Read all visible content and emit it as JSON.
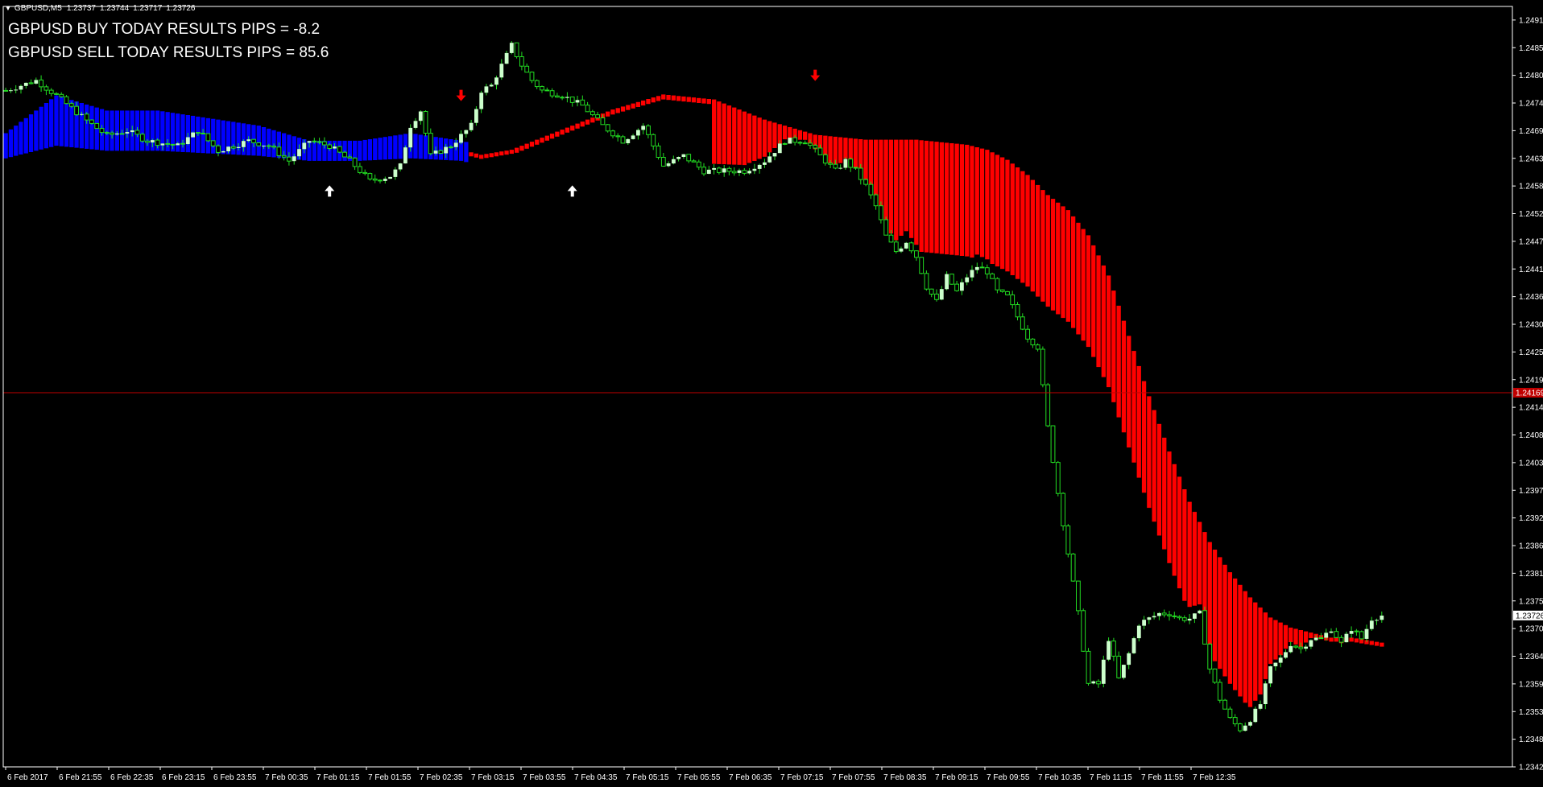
{
  "header": {
    "symbol": "GBPUSD,M5",
    "ohlc": [
      "1.23737",
      "1.23744",
      "1.23717",
      "1.23726"
    ]
  },
  "results": {
    "buy": "GBPUSD BUY TODAY RESULTS PIPS = -8.2",
    "sell": "GBPUSD SELL TODAY RESULTS PIPS = 85.6"
  },
  "colors": {
    "background": "#000000",
    "axis": "#ffffff",
    "candle_bull": "#ccffcc",
    "candle_wick": "#22dd22",
    "band_up": "#0000ff",
    "band_down": "#ff0000",
    "level_line": "#c00000",
    "arrow_buy": "#ffffff",
    "arrow_sell": "#ff0000"
  },
  "chart_data": {
    "type": "candlestick",
    "symbol": "GBPUSD",
    "timeframe": "M5",
    "ylim": [
      1.23425,
      1.24937
    ],
    "y_ticks": [
      "1.24910",
      "1.24855",
      "1.24800",
      "1.24745",
      "1.24690",
      "1.24635",
      "1.24580",
      "1.24525",
      "1.24470",
      "1.24415",
      "1.24360",
      "1.24305",
      "1.24250",
      "1.24195",
      "1.24140",
      "1.24085",
      "1.24030",
      "1.23975",
      "1.23920",
      "1.23865",
      "1.23810",
      "1.23755",
      "1.23700",
      "1.23645",
      "1.23590",
      "1.23535",
      "1.23480",
      "1.23425"
    ],
    "x_ticks": [
      "6 Feb 2017",
      "6 Feb 21:55",
      "6 Feb 22:35",
      "6 Feb 23:15",
      "6 Feb 23:55",
      "7 Feb 00:35",
      "7 Feb 01:15",
      "7 Feb 01:55",
      "7 Feb 02:35",
      "7 Feb 03:15",
      "7 Feb 03:55",
      "7 Feb 04:35",
      "7 Feb 05:15",
      "7 Feb 05:55",
      "7 Feb 06:35",
      "7 Feb 07:15",
      "7 Feb 07:55",
      "7 Feb 08:35",
      "7 Feb 09:15",
      "7 Feb 09:55",
      "7 Feb 10:35",
      "7 Feb 11:15",
      "7 Feb 11:55",
      "7 Feb 12:35"
    ],
    "horizontal_line": {
      "price": 1.24169,
      "label": "1.24169"
    },
    "current_price": {
      "price": 1.23726,
      "label": "1.23726"
    },
    "close_path": [
      [
        0,
        1.2477
      ],
      [
        6,
        1.2479
      ],
      [
        10,
        1.2476
      ],
      [
        16,
        1.2471
      ],
      [
        20,
        1.2468
      ],
      [
        24,
        1.2469
      ],
      [
        28,
        1.2467
      ],
      [
        34,
        1.2466
      ],
      [
        38,
        1.2469
      ],
      [
        42,
        1.2465
      ],
      [
        48,
        1.2467
      ],
      [
        52,
        1.2466
      ],
      [
        56,
        1.2463
      ],
      [
        60,
        1.2467
      ],
      [
        64,
        1.2466
      ],
      [
        68,
        1.2463
      ],
      [
        72,
        1.2459
      ],
      [
        76,
        1.246
      ],
      [
        78,
        1.2462
      ],
      [
        80,
        1.247
      ],
      [
        82,
        1.2473
      ],
      [
        84,
        1.2464
      ],
      [
        88,
        1.2466
      ],
      [
        92,
        1.247
      ],
      [
        94,
        1.2477
      ],
      [
        96,
        1.2478
      ],
      [
        98,
        1.2482
      ],
      [
        100,
        1.2486
      ],
      [
        102,
        1.2482
      ],
      [
        104,
        1.2479
      ],
      [
        106,
        1.2477
      ],
      [
        110,
        1.2476
      ],
      [
        114,
        1.2474
      ],
      [
        118,
        1.247
      ],
      [
        122,
        1.2467
      ],
      [
        126,
        1.247
      ],
      [
        130,
        1.2462
      ],
      [
        134,
        1.2464
      ],
      [
        138,
        1.2461
      ],
      [
        142,
        1.2461
      ],
      [
        146,
        1.2461
      ],
      [
        150,
        1.2463
      ],
      [
        154,
        1.2467
      ],
      [
        158,
        1.2467
      ],
      [
        162,
        1.2463
      ],
      [
        164,
        1.2461
      ],
      [
        166,
        1.2463
      ],
      [
        168,
        1.2461
      ],
      [
        170,
        1.2458
      ],
      [
        172,
        1.2454
      ],
      [
        174,
        1.2448
      ],
      [
        176,
        1.2445
      ],
      [
        178,
        1.2447
      ],
      [
        180,
        1.2444
      ],
      [
        182,
        1.2438
      ],
      [
        184,
        1.2435
      ],
      [
        186,
        1.244
      ],
      [
        188,
        1.2437
      ],
      [
        190,
        1.244
      ],
      [
        192,
        1.2442
      ],
      [
        194,
        1.2441
      ],
      [
        196,
        1.2437
      ],
      [
        198,
        1.2436
      ],
      [
        200,
        1.2432
      ],
      [
        202,
        1.2428
      ],
      [
        204,
        1.2426
      ],
      [
        206,
        1.241
      ],
      [
        208,
        1.2397
      ],
      [
        210,
        1.2385
      ],
      [
        212,
        1.2373
      ],
      [
        214,
        1.2359
      ],
      [
        216,
        1.2359
      ],
      [
        218,
        1.2368
      ],
      [
        220,
        1.236
      ],
      [
        222,
        1.2365
      ],
      [
        224,
        1.2371
      ],
      [
        226,
        1.2372
      ],
      [
        228,
        1.2373
      ],
      [
        230,
        1.2373
      ],
      [
        232,
        1.2372
      ],
      [
        234,
        1.2372
      ],
      [
        236,
        1.2373
      ],
      [
        238,
        1.2362
      ],
      [
        240,
        1.2356
      ],
      [
        242,
        1.2352
      ],
      [
        244,
        1.235
      ],
      [
        246,
        1.2352
      ],
      [
        248,
        1.2355
      ],
      [
        250,
        1.2362
      ],
      [
        252,
        1.2364
      ],
      [
        254,
        1.2367
      ],
      [
        256,
        1.2366
      ],
      [
        258,
        1.2368
      ],
      [
        260,
        1.2368
      ],
      [
        262,
        1.237
      ],
      [
        264,
        1.2367
      ],
      [
        266,
        1.237
      ],
      [
        268,
        1.2368
      ],
      [
        270,
        1.2372
      ],
      [
        272,
        1.23726
      ]
    ],
    "band_path": [
      [
        0,
        1.2466
      ],
      [
        10,
        1.2471
      ],
      [
        20,
        1.2469
      ],
      [
        30,
        1.2469
      ],
      [
        40,
        1.2468
      ],
      [
        50,
        1.2467
      ],
      [
        60,
        1.2465
      ],
      [
        70,
        1.2465
      ],
      [
        80,
        1.2466
      ],
      [
        90,
        1.2465
      ],
      [
        94,
        1.2464
      ],
      [
        100,
        1.2465
      ],
      [
        110,
        1.2469
      ],
      [
        120,
        1.2473
      ],
      [
        130,
        1.2476
      ],
      [
        140,
        1.2475
      ],
      [
        150,
        1.2471
      ],
      [
        160,
        1.2468
      ],
      [
        170,
        1.2467
      ],
      [
        180,
        1.2467
      ],
      [
        190,
        1.2466
      ],
      [
        194,
        1.2465
      ],
      [
        198,
        1.2463
      ],
      [
        202,
        1.246
      ],
      [
        206,
        1.2456
      ],
      [
        210,
        1.2453
      ],
      [
        214,
        1.2448
      ],
      [
        218,
        1.244
      ],
      [
        222,
        1.2428
      ],
      [
        226,
        1.2416
      ],
      [
        230,
        1.2405
      ],
      [
        234,
        1.2395
      ],
      [
        238,
        1.2387
      ],
      [
        242,
        1.2381
      ],
      [
        246,
        1.2376
      ],
      [
        250,
        1.2372
      ],
      [
        254,
        1.237
      ],
      [
        258,
        1.2369
      ],
      [
        262,
        1.2368
      ],
      [
        266,
        1.2368
      ],
      [
        272,
        1.2367
      ]
    ],
    "band_color_change_index": 92,
    "arrows": [
      {
        "type": "sell",
        "bar": 90,
        "price": 1.2476
      },
      {
        "type": "buy",
        "bar": 64,
        "price": 1.2457
      },
      {
        "type": "buy",
        "bar": 112,
        "price": 1.2457
      },
      {
        "type": "sell",
        "bar": 160,
        "price": 1.248
      }
    ]
  }
}
